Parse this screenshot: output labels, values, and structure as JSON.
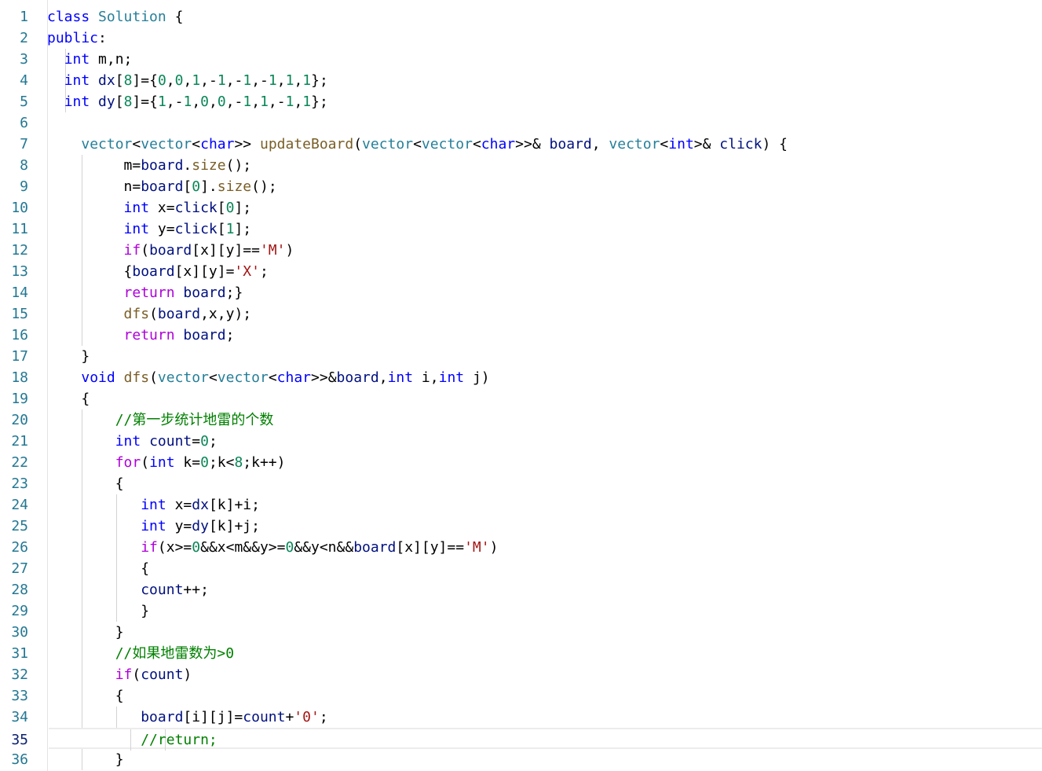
{
  "editor": {
    "language": "cpp",
    "active_line": 35,
    "colors": {
      "background": "#ffffff",
      "line_number": "#237893",
      "keyword": "#0000ff",
      "type": "#267f99",
      "function": "#795e26",
      "variable": "#001080",
      "number": "#098658",
      "string": "#a31515",
      "control": "#af00db",
      "comment": "#008000"
    },
    "lines": [
      {
        "n": "1",
        "text": "class Solution {"
      },
      {
        "n": "2",
        "text": "public:"
      },
      {
        "n": "3",
        "text": "  int m,n;"
      },
      {
        "n": "4",
        "text": "  int dx[8]={0,0,1,-1,-1,-1,1,1};"
      },
      {
        "n": "5",
        "text": "  int dy[8]={1,-1,0,0,-1,1,-1,1};"
      },
      {
        "n": "6",
        "text": ""
      },
      {
        "n": "7",
        "text": "    vector<vector<char>> updateBoard(vector<vector<char>>& board, vector<int>& click) {"
      },
      {
        "n": "8",
        "text": "         m=board.size();"
      },
      {
        "n": "9",
        "text": "         n=board[0].size();"
      },
      {
        "n": "10",
        "text": "         int x=click[0];"
      },
      {
        "n": "11",
        "text": "         int y=click[1];"
      },
      {
        "n": "12",
        "text": "         if(board[x][y]=='M')"
      },
      {
        "n": "13",
        "text": "         {board[x][y]='X';"
      },
      {
        "n": "14",
        "text": "         return board;}"
      },
      {
        "n": "15",
        "text": "         dfs(board,x,y);"
      },
      {
        "n": "16",
        "text": "         return board;"
      },
      {
        "n": "17",
        "text": "    }"
      },
      {
        "n": "18",
        "text": "    void dfs(vector<vector<char>>&board,int i,int j)"
      },
      {
        "n": "19",
        "text": "    {"
      },
      {
        "n": "20",
        "text": "        //第一步统计地雷的个数"
      },
      {
        "n": "21",
        "text": "        int count=0;"
      },
      {
        "n": "22",
        "text": "        for(int k=0;k<8;k++)"
      },
      {
        "n": "23",
        "text": "        {"
      },
      {
        "n": "24",
        "text": "           int x=dx[k]+i;"
      },
      {
        "n": "25",
        "text": "           int y=dy[k]+j;"
      },
      {
        "n": "26",
        "text": "           if(x>=0&&x<m&&y>=0&&y<n&&board[x][y]=='M')"
      },
      {
        "n": "27",
        "text": "           {"
      },
      {
        "n": "28",
        "text": "           count++;"
      },
      {
        "n": "29",
        "text": "           }"
      },
      {
        "n": "30",
        "text": "        }"
      },
      {
        "n": "31",
        "text": "        //如果地雷数为>0"
      },
      {
        "n": "32",
        "text": "        if(count)"
      },
      {
        "n": "33",
        "text": "        {"
      },
      {
        "n": "34",
        "text": "           board[i][j]=count+'0';"
      },
      {
        "n": "35",
        "text": "           //return;"
      },
      {
        "n": "36",
        "text": "        }"
      }
    ]
  }
}
